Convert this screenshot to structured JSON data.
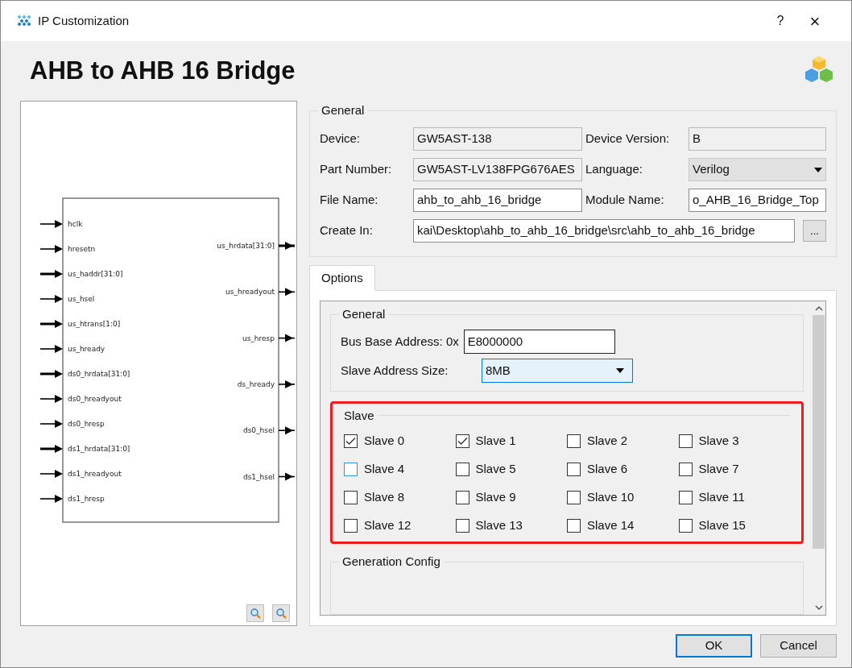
{
  "window": {
    "title": "IP Customization",
    "help": "?",
    "close": "×"
  },
  "header": {
    "title": "AHB to AHB 16 Bridge"
  },
  "diagram": {
    "inputs": [
      {
        "name": "hclk",
        "bus": false
      },
      {
        "name": "hresetn",
        "bus": false
      },
      {
        "name": "us_haddr[31:0]",
        "bus": true
      },
      {
        "name": "us_hsel",
        "bus": false
      },
      {
        "name": "us_htrans[1:0]",
        "bus": true
      },
      {
        "name": "us_hready",
        "bus": false
      },
      {
        "name": "ds0_hrdata[31:0]",
        "bus": true
      },
      {
        "name": "ds0_hreadyout",
        "bus": false
      },
      {
        "name": "ds0_hresp",
        "bus": false
      },
      {
        "name": "ds1_hrdata[31:0]",
        "bus": true
      },
      {
        "name": "ds1_hreadyout",
        "bus": false
      },
      {
        "name": "ds1_hresp",
        "bus": false
      }
    ],
    "outputs": [
      {
        "name": "us_hrdata[31:0]",
        "bus": true
      },
      {
        "name": "us_hreadyout",
        "bus": false
      },
      {
        "name": "us_hresp",
        "bus": false
      },
      {
        "name": "ds_hready",
        "bus": false
      },
      {
        "name": "ds0_hsel",
        "bus": false
      },
      {
        "name": "ds1_hsel",
        "bus": false
      }
    ]
  },
  "general": {
    "title": "General",
    "fields": [
      {
        "label": "Device:",
        "value": "GW5AST-138",
        "kind": "readonly"
      },
      {
        "label": "Device Version:",
        "value": "B",
        "kind": "readonly"
      },
      {
        "label": "Part Number:",
        "value": "GW5AST-LV138FPG676AES",
        "kind": "readonly"
      },
      {
        "label": "Language:",
        "value": "Verilog",
        "kind": "select"
      },
      {
        "label": "File Name:",
        "value": "ahb_to_ahb_16_bridge",
        "kind": "text"
      },
      {
        "label": "Module Name:",
        "value": "o_AHB_16_Bridge_Top",
        "kind": "text"
      }
    ],
    "create_in": {
      "label": "Create In:",
      "value": "kai\\Desktop\\ahb_to_ahb_16_bridge\\src\\ahb_to_ahb_16_bridge",
      "browse": "..."
    }
  },
  "tabs": [
    {
      "label": "Options",
      "selected": true
    }
  ],
  "options": {
    "general": {
      "title": "General",
      "base_address": {
        "label": "Bus Base Address: 0x",
        "value": "E8000000"
      },
      "address_size": {
        "label": "Slave Address Size:",
        "value": "8MB",
        "focused": true
      }
    },
    "slave": {
      "title": "Slave",
      "highlighted": true,
      "slaves": [
        {
          "label": "Slave 0",
          "checked": true,
          "focused": false
        },
        {
          "label": "Slave 1",
          "checked": true,
          "focused": false
        },
        {
          "label": "Slave 2",
          "checked": false,
          "focused": false
        },
        {
          "label": "Slave 3",
          "checked": false,
          "focused": false
        },
        {
          "label": "Slave 4",
          "checked": false,
          "focused": true
        },
        {
          "label": "Slave 5",
          "checked": false,
          "focused": false
        },
        {
          "label": "Slave 6",
          "checked": false,
          "focused": false
        },
        {
          "label": "Slave 7",
          "checked": false,
          "focused": false
        },
        {
          "label": "Slave 8",
          "checked": false,
          "focused": false
        },
        {
          "label": "Slave 9",
          "checked": false,
          "focused": false
        },
        {
          "label": "Slave 10",
          "checked": false,
          "focused": false
        },
        {
          "label": "Slave 11",
          "checked": false,
          "focused": false
        },
        {
          "label": "Slave 12",
          "checked": false,
          "focused": false
        },
        {
          "label": "Slave 13",
          "checked": false,
          "focused": false
        },
        {
          "label": "Slave 14",
          "checked": false,
          "focused": false
        },
        {
          "label": "Slave 15",
          "checked": false,
          "focused": false
        }
      ]
    },
    "generation_config": {
      "title": "Generation Config"
    }
  },
  "buttons": [
    {
      "label": "OK",
      "default": true
    },
    {
      "label": "Cancel",
      "default": false
    }
  ]
}
